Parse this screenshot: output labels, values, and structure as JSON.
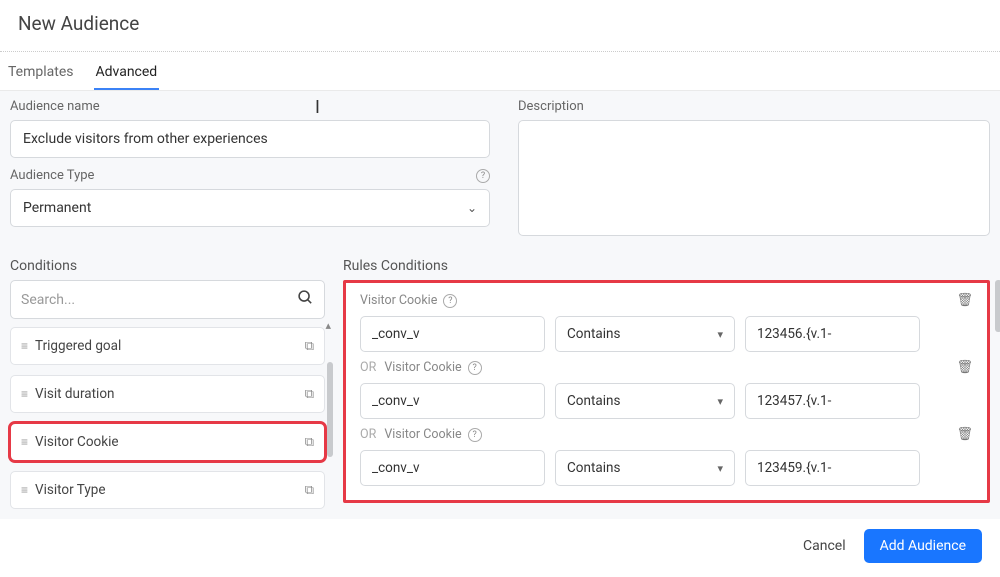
{
  "page": {
    "title": "New Audience"
  },
  "tabs": {
    "templates": "Templates",
    "advanced": "Advanced"
  },
  "form": {
    "name_label": "Audience name",
    "name_value": "Exclude visitors from other experiences",
    "type_label": "Audience Type",
    "type_value": "Permanent",
    "desc_label": "Description",
    "desc_value": ""
  },
  "conditions": {
    "title": "Conditions",
    "search_placeholder": "Search...",
    "items": [
      {
        "label": "Triggered goal"
      },
      {
        "label": "Visit duration"
      },
      {
        "label": "Visitor Cookie",
        "highlight": true
      },
      {
        "label": "Visitor Type"
      }
    ]
  },
  "rules": {
    "title": "Rules Conditions",
    "cookie_label": "Visitor Cookie",
    "or_label": "OR",
    "rows": [
      {
        "field": "_conv_v",
        "op": "Contains",
        "value": "123456.{v.1-",
        "or": false
      },
      {
        "field": "_conv_v",
        "op": "Contains",
        "value": "123457.{v.1-",
        "or": true
      },
      {
        "field": "_conv_v",
        "op": "Contains",
        "value": "123459.{v.1-",
        "or": true
      }
    ]
  },
  "footer": {
    "cancel": "Cancel",
    "add": "Add Audience"
  }
}
